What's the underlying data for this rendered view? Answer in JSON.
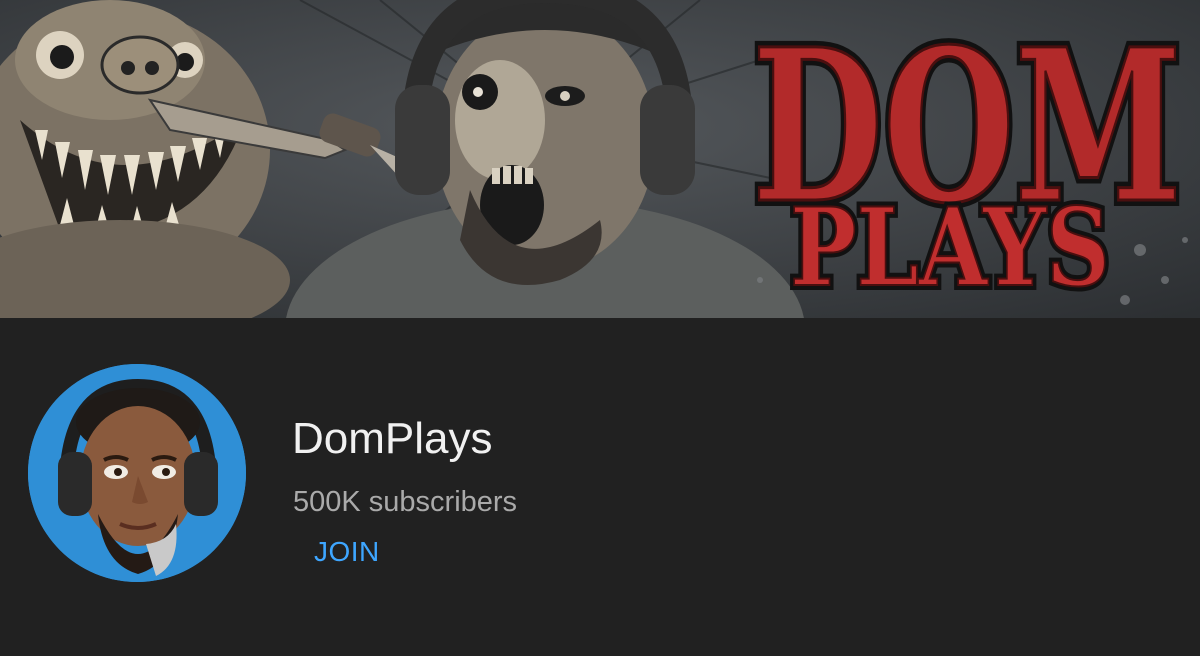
{
  "banner": {
    "logo_word_top": "DOM",
    "logo_word_bottom": "PLAYS",
    "logo_color": "#b22a2a"
  },
  "channel": {
    "name": "DomPlays",
    "subscribers": "500K subscribers",
    "join_label": "JOIN"
  },
  "colors": {
    "background": "#212121",
    "accent": "#3ea6ff",
    "avatar_ring": "#2f8fd6"
  }
}
